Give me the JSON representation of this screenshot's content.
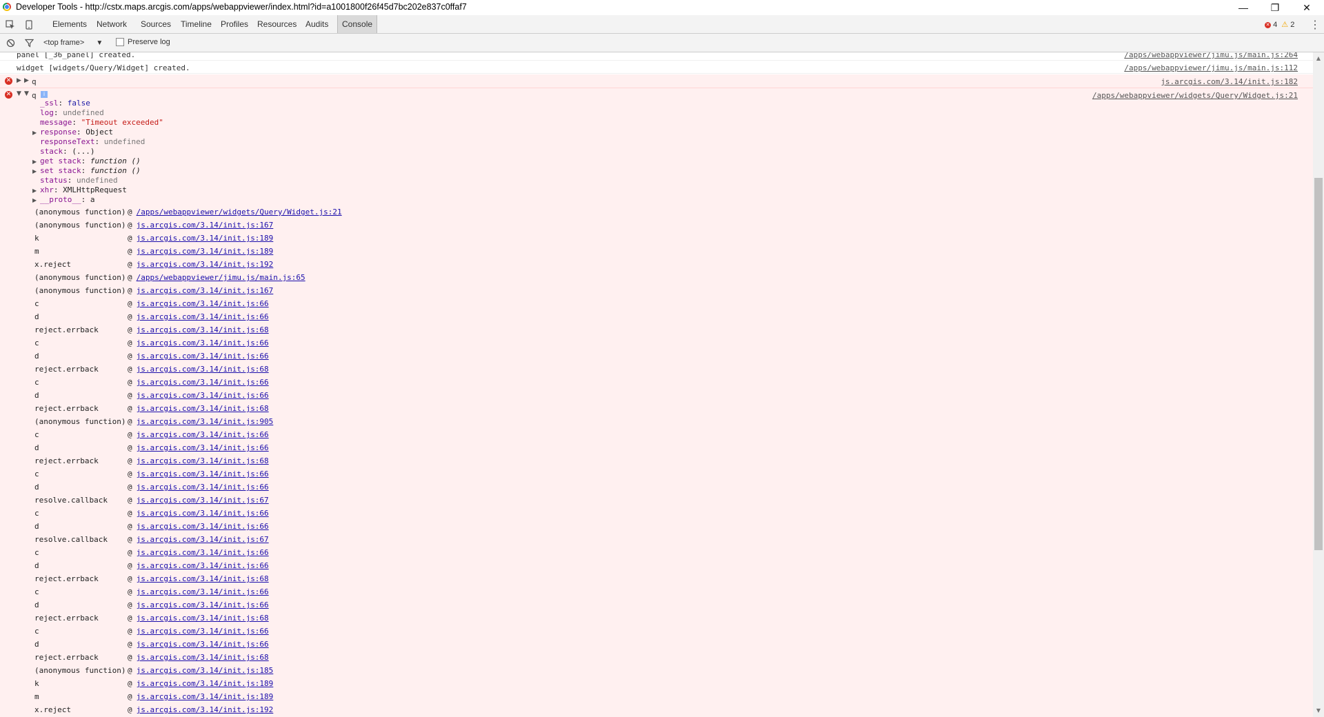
{
  "window": {
    "title": "Developer Tools - http://cstx.maps.arcgis.com/apps/webappviewer/index.html?id=a1001800f26f45d7bc202e837c0ffaf7",
    "minimize_glyph": "—",
    "restore_glyph": "❐",
    "close_glyph": "✕"
  },
  "toolbar": {
    "tabs": [
      "Elements",
      "Network",
      "Sources",
      "Timeline",
      "Profiles",
      "Resources",
      "Audits",
      "Console"
    ],
    "active_tab": "Console",
    "error_count": "4",
    "warning_count": "2"
  },
  "filterbar": {
    "frame": "<top frame>",
    "preserve_log_label": "Preserve log",
    "preserve_log_checked": false
  },
  "console": {
    "messages": [
      {
        "text": "panel [_36_panel] created.",
        "source": "/apps/webappviewer/jimu.js/main.js:264",
        "level": "log"
      },
      {
        "text": "widget [widgets/Query/Widget] created.",
        "source": "/apps/webappviewer/jimu.js/main.js:112",
        "level": "log"
      },
      {
        "text": "q",
        "source": "js.arcgis.com/3.14/init.js:182",
        "level": "error",
        "expanded": false
      },
      {
        "text": "q",
        "source": "/apps/webappviewer/widgets/Query/Widget.js:21",
        "level": "error",
        "expanded": true
      }
    ],
    "info_badge": "i",
    "object_props": [
      {
        "key": "_ssl",
        "value": "false",
        "type": "bool",
        "expandable": false
      },
      {
        "key": "log",
        "value": "undefined",
        "type": "undef",
        "expandable": false
      },
      {
        "key": "message",
        "value": "\"Timeout exceeded\"",
        "type": "str",
        "expandable": false
      },
      {
        "key": "response",
        "value": "Object",
        "type": "plain",
        "expandable": true
      },
      {
        "key": "responseText",
        "value": "undefined",
        "type": "undef",
        "expandable": false
      },
      {
        "key": "stack",
        "value": "(...)",
        "type": "plain",
        "expandable": false
      },
      {
        "key": "get stack",
        "value": "function ()",
        "type": "fn",
        "expandable": true
      },
      {
        "key": "set stack",
        "value": "function ()",
        "type": "fn",
        "expandable": true
      },
      {
        "key": "status",
        "value": "undefined",
        "type": "undef",
        "expandable": false
      },
      {
        "key": "xhr",
        "value": "XMLHttpRequest",
        "type": "plain",
        "expandable": true
      },
      {
        "key": "__proto__",
        "value": "a",
        "type": "plain",
        "expandable": true
      }
    ],
    "stack_trace": [
      {
        "fn": "(anonymous function)",
        "loc": "/apps/webappviewer/widgets/Query/Widget.js:21"
      },
      {
        "fn": "(anonymous function)",
        "loc": "js.arcgis.com/3.14/init.js:167"
      },
      {
        "fn": "k",
        "loc": "js.arcgis.com/3.14/init.js:189"
      },
      {
        "fn": "m",
        "loc": "js.arcgis.com/3.14/init.js:189"
      },
      {
        "fn": "x.reject",
        "loc": "js.arcgis.com/3.14/init.js:192"
      },
      {
        "fn": "(anonymous function)",
        "loc": "/apps/webappviewer/jimu.js/main.js:65"
      },
      {
        "fn": "(anonymous function)",
        "loc": "js.arcgis.com/3.14/init.js:167"
      },
      {
        "fn": "c",
        "loc": "js.arcgis.com/3.14/init.js:66"
      },
      {
        "fn": "d",
        "loc": "js.arcgis.com/3.14/init.js:66"
      },
      {
        "fn": "reject.errback",
        "loc": "js.arcgis.com/3.14/init.js:68"
      },
      {
        "fn": "c",
        "loc": "js.arcgis.com/3.14/init.js:66"
      },
      {
        "fn": "d",
        "loc": "js.arcgis.com/3.14/init.js:66"
      },
      {
        "fn": "reject.errback",
        "loc": "js.arcgis.com/3.14/init.js:68"
      },
      {
        "fn": "c",
        "loc": "js.arcgis.com/3.14/init.js:66"
      },
      {
        "fn": "d",
        "loc": "js.arcgis.com/3.14/init.js:66"
      },
      {
        "fn": "reject.errback",
        "loc": "js.arcgis.com/3.14/init.js:68"
      },
      {
        "fn": "(anonymous function)",
        "loc": "js.arcgis.com/3.14/init.js:905"
      },
      {
        "fn": "c",
        "loc": "js.arcgis.com/3.14/init.js:66"
      },
      {
        "fn": "d",
        "loc": "js.arcgis.com/3.14/init.js:66"
      },
      {
        "fn": "reject.errback",
        "loc": "js.arcgis.com/3.14/init.js:68"
      },
      {
        "fn": "c",
        "loc": "js.arcgis.com/3.14/init.js:66"
      },
      {
        "fn": "d",
        "loc": "js.arcgis.com/3.14/init.js:66"
      },
      {
        "fn": "resolve.callback",
        "loc": "js.arcgis.com/3.14/init.js:67"
      },
      {
        "fn": "c",
        "loc": "js.arcgis.com/3.14/init.js:66"
      },
      {
        "fn": "d",
        "loc": "js.arcgis.com/3.14/init.js:66"
      },
      {
        "fn": "resolve.callback",
        "loc": "js.arcgis.com/3.14/init.js:67"
      },
      {
        "fn": "c",
        "loc": "js.arcgis.com/3.14/init.js:66"
      },
      {
        "fn": "d",
        "loc": "js.arcgis.com/3.14/init.js:66"
      },
      {
        "fn": "reject.errback",
        "loc": "js.arcgis.com/3.14/init.js:68"
      },
      {
        "fn": "c",
        "loc": "js.arcgis.com/3.14/init.js:66"
      },
      {
        "fn": "d",
        "loc": "js.arcgis.com/3.14/init.js:66"
      },
      {
        "fn": "reject.errback",
        "loc": "js.arcgis.com/3.14/init.js:68"
      },
      {
        "fn": "c",
        "loc": "js.arcgis.com/3.14/init.js:66"
      },
      {
        "fn": "d",
        "loc": "js.arcgis.com/3.14/init.js:66"
      },
      {
        "fn": "reject.errback",
        "loc": "js.arcgis.com/3.14/init.js:68"
      },
      {
        "fn": "(anonymous function)",
        "loc": "js.arcgis.com/3.14/init.js:185"
      },
      {
        "fn": "k",
        "loc": "js.arcgis.com/3.14/init.js:189"
      },
      {
        "fn": "m",
        "loc": "js.arcgis.com/3.14/init.js:189"
      },
      {
        "fn": "x.reject",
        "loc": "js.arcgis.com/3.14/init.js:192"
      }
    ]
  }
}
